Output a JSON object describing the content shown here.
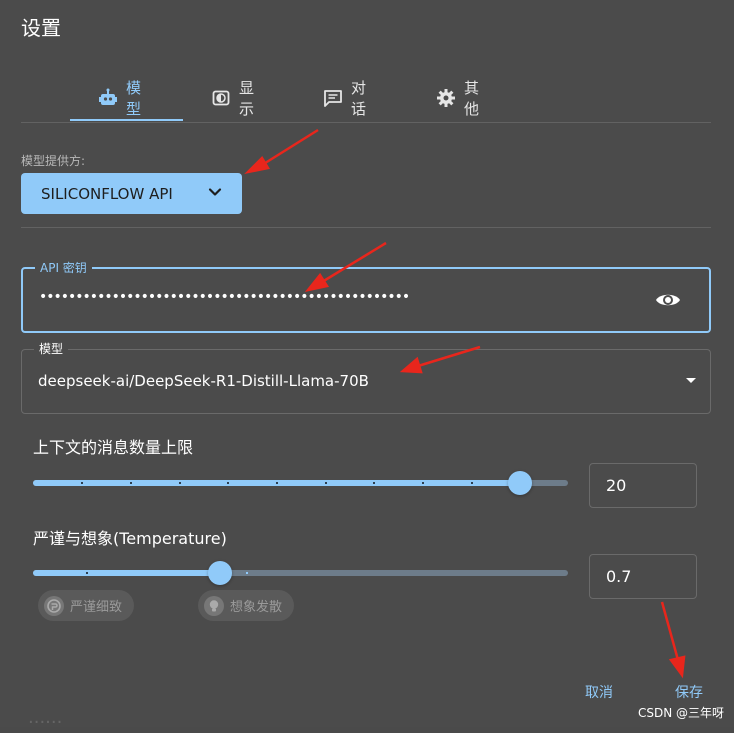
{
  "dialog": {
    "title": "设置"
  },
  "tabs": [
    {
      "label": "模型",
      "icon": "robot-icon",
      "active": true
    },
    {
      "label": "显示",
      "icon": "display-icon",
      "active": false
    },
    {
      "label": "对话",
      "icon": "chat-icon",
      "active": false
    },
    {
      "label": "其他",
      "icon": "gear-icon",
      "active": false
    }
  ],
  "provider": {
    "label": "模型提供方:",
    "value": "SILICONFLOW API"
  },
  "api_key": {
    "label": "API 密钥",
    "value": "•••••••••••••••••••••••••••••••••••••••••••••••••••"
  },
  "model": {
    "label": "模型",
    "value": "deepseek-ai/DeepSeek-R1-Distill-Llama-70B"
  },
  "context_limit": {
    "label": "上下文的消息数量上限",
    "value": "20",
    "fraction": 0.91
  },
  "temperature": {
    "label": "严谨与想象(Temperature)",
    "value": "0.7",
    "fraction": 0.35,
    "chip_left": "严谨细致",
    "chip_right": "想象发散"
  },
  "actions": {
    "cancel": "取消",
    "save": "保存"
  },
  "watermark": "CSDN @三年呀",
  "colors": {
    "accent": "#90caf9",
    "background": "#4b4b4b",
    "arrow": "#e8261c"
  }
}
